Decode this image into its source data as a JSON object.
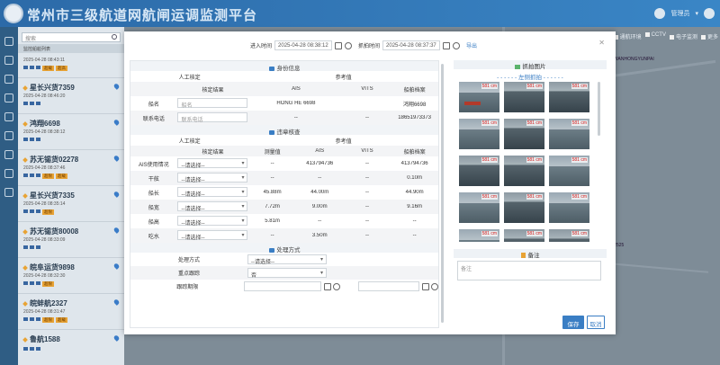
{
  "app": {
    "title": "常州市三级航道网航闸运调监测平台",
    "user": "管理员",
    "colors": {
      "header": "#2c6aa8",
      "accent": "#3a7ec4",
      "tag": "#e8a335",
      "measure": "#d21a1a"
    }
  },
  "sidebar": {
    "search_placeholder": "搜索",
    "list_title": "监控船舶列表",
    "items": [
      {
        "name": "",
        "time": "2025-04-28 08:43:11",
        "tags": [
          "超载",
          "超高"
        ]
      },
      {
        "name": "星长兴货7359",
        "time": "2025-04-28 08:46:20",
        "tags": []
      },
      {
        "name": "鸿翔6698",
        "time": "2025-04-28 08:38:12",
        "tags": []
      },
      {
        "name": "苏无锡货02278",
        "time": "2025-04-28 08:37:46",
        "tags": [
          "超限",
          "超载"
        ]
      },
      {
        "name": "星长兴货7335",
        "time": "2025-04-28 08:35:14",
        "tags": [
          "超限"
        ]
      },
      {
        "name": "苏无锡货80008",
        "time": "2025-04-28 08:33:09",
        "tags": []
      },
      {
        "name": "皖阜运货9898",
        "time": "2025-04-28 08:32:30",
        "tags": [
          "超限"
        ]
      },
      {
        "name": "皖蚌航2327",
        "time": "2025-04-28 08:31:47",
        "tags": [
          "超限",
          "超载"
        ]
      },
      {
        "name": "鲁航1588",
        "time": "",
        "tags": []
      }
    ]
  },
  "map": {
    "toolbar": [
      "通航环境",
      "CCTV",
      "电子监测",
      "更多"
    ],
    "label1": "WANHONGYUNPAI",
    "label2": "2.2525"
  },
  "modal": {
    "entry_label": "进入时间",
    "entry_time": "2025-04-28 08:38:12",
    "capture_label": "抓拍时间",
    "capture_time": "2025-04-28 08:37:37",
    "export_label": "导出",
    "identity": {
      "title": "身份信息",
      "manual_label": "人工核定",
      "reference_label": "参考值",
      "cols": [
        "核定结果",
        "AIS",
        "VITS",
        "船舶档案"
      ],
      "rows": [
        {
          "label": "船名",
          "placeholder": "船名",
          "ais": "HONG HE 6698",
          "vits": "",
          "archive": "鸿翔6698"
        },
        {
          "label": "联系电话",
          "placeholder": "联系电话",
          "ais": "--",
          "vits": "--",
          "archive": "18651973373"
        }
      ]
    },
    "violation": {
      "title": "违章核查",
      "manual_label": "人工核定",
      "reference_label": "参考值",
      "cols": [
        "核定结果",
        "测量值",
        "AIS",
        "VITS",
        "船舶档案"
      ],
      "select_default": "--请选择--",
      "rows": [
        {
          "label": "AIS使用情况",
          "measure": "--",
          "ais": "413794736",
          "vits": "--",
          "archive": "413794736"
        },
        {
          "label": "干舷",
          "measure": "--",
          "ais": "--",
          "vits": "--",
          "archive": "0.10m"
        },
        {
          "label": "船长",
          "measure": "45.88m",
          "ais": "44.00m",
          "vits": "--",
          "archive": "44.90m"
        },
        {
          "label": "船宽",
          "measure": "7.72m",
          "ais": "9.00m",
          "vits": "--",
          "archive": "9.16m"
        },
        {
          "label": "船高",
          "measure": "5.81m",
          "ais": "--",
          "vits": "--",
          "archive": "--"
        },
        {
          "label": "吃水",
          "measure": "--",
          "ais": "3.50m",
          "vits": "--",
          "archive": "--"
        }
      ]
    },
    "handling": {
      "title": "处理方式",
      "method_label": "处理方式",
      "method_value": "--请选择--",
      "track_label": "重点跟踪",
      "track_value": "否",
      "deadline_label": "跟踪期限"
    },
    "snapshots": {
      "title": "抓拍图片",
      "camera": "左侧抓拍",
      "measure_label": "581 cm",
      "count": 18
    },
    "note": {
      "title": "备注",
      "placeholder": "备注"
    },
    "save_label": "保存",
    "cancel_label": "取消"
  }
}
